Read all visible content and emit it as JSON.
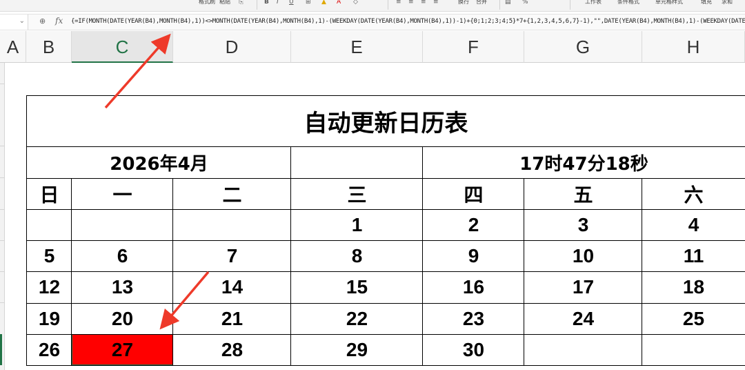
{
  "ribbon": {
    "format_brush": "格式刷",
    "paste": "粘贴",
    "wrap": "换行",
    "merge": "合并",
    "worksheet": "工作表",
    "cond_format": "条件格式",
    "cell_style": "单元格样式",
    "fill": "填充",
    "sum": "求和",
    "bold": "B",
    "italic": "I",
    "underline": "U",
    "percent": "%"
  },
  "formula_bar": {
    "fx_label": "fx",
    "formula": "{=IF(MONTH(DATE(YEAR(B4),MONTH(B4),1))<>MONTH(DATE(YEAR(B4),MONTH(B4),1)-(WEEKDAY(DATE(YEAR(B4),MONTH(B4),1))-1)+{0;1;2;3;4;5}*7+{1,2,3,4,5,6,7}-1),\"\",DATE(YEAR(B4),MONTH(B4),1)-(WEEKDAY(DATE(YEAR"
  },
  "columns": [
    "A",
    "B",
    "C",
    "D",
    "E",
    "F",
    "G",
    "H"
  ],
  "selected_column": "C",
  "calendar": {
    "title": "自动更新日历表",
    "month_label": "2026年4月",
    "time_label": "17时47分18秒",
    "weekdays": [
      "日",
      "一",
      "二",
      "三",
      "四",
      "五",
      "六"
    ],
    "weeks": [
      [
        "",
        "",
        "",
        "1",
        "2",
        "3",
        "4"
      ],
      [
        "5",
        "6",
        "7",
        "8",
        "9",
        "10",
        "11"
      ],
      [
        "12",
        "13",
        "14",
        "15",
        "16",
        "17",
        "18"
      ],
      [
        "19",
        "20",
        "21",
        "22",
        "23",
        "24",
        "25"
      ],
      [
        "26",
        "27",
        "28",
        "29",
        "30",
        "",
        ""
      ]
    ],
    "today": "27",
    "today_color": "#ff0000"
  },
  "colors": {
    "arrow": "#ee3a2a",
    "selection": "#217346"
  }
}
